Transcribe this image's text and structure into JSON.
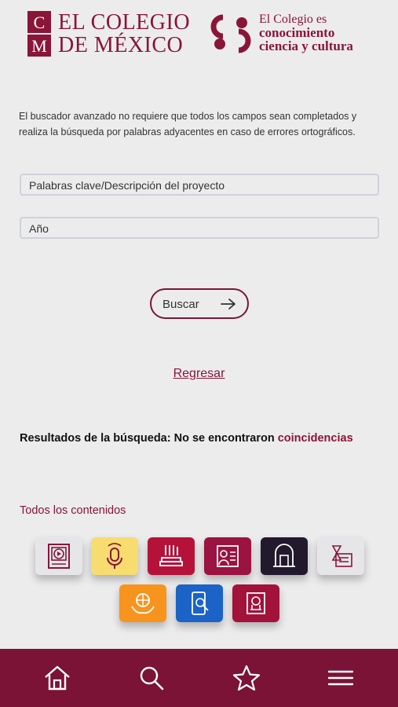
{
  "header": {
    "logo_letters": [
      "C",
      "M"
    ],
    "name_line1": "EL COLEGIO",
    "name_line2": "DE MÉXICO",
    "tagline_line1": "El Colegio es",
    "tagline_line2": "conocimiento",
    "tagline_line3": "ciencia y cultura"
  },
  "intro_text": "El buscador avanzado no requiere que todos los campos sean completados y realiza la búsqueda por palabras adyacentes en caso de errores ortográficos.",
  "form": {
    "keywords_placeholder": "Palabras clave/Descripción del proyecto",
    "year_placeholder": "Año",
    "search_label": "Buscar"
  },
  "back_link": "Regresar",
  "results": {
    "prefix": "Resultados de la búsqueda: No se encontraron ",
    "highlight": "coincidencias"
  },
  "all_content_label": "Todos los contenidos",
  "categories": [
    {
      "icon": "video-icon",
      "color": "#e6e6e9"
    },
    {
      "icon": "microphone-icon",
      "color": "#f7dc6f"
    },
    {
      "icon": "books-icon",
      "color": "#b5123a"
    },
    {
      "icon": "profile-card-icon",
      "color": "#9b1340"
    },
    {
      "icon": "archive-building-icon",
      "color": "#221a2c"
    },
    {
      "icon": "hourglass-document-icon",
      "color": "#e6e6e9"
    },
    {
      "icon": "globe-hands-icon",
      "color": "#f7941d"
    },
    {
      "icon": "phone-search-icon",
      "color": "#1b63c6"
    },
    {
      "icon": "museum-exhibit-icon",
      "color": "#a3123a"
    }
  ],
  "colors": {
    "brand": "#8a1538",
    "nav_bar": "#7a1336",
    "background": "#ececed"
  },
  "nav": [
    "home-icon",
    "search-icon",
    "star-icon",
    "menu-icon"
  ]
}
